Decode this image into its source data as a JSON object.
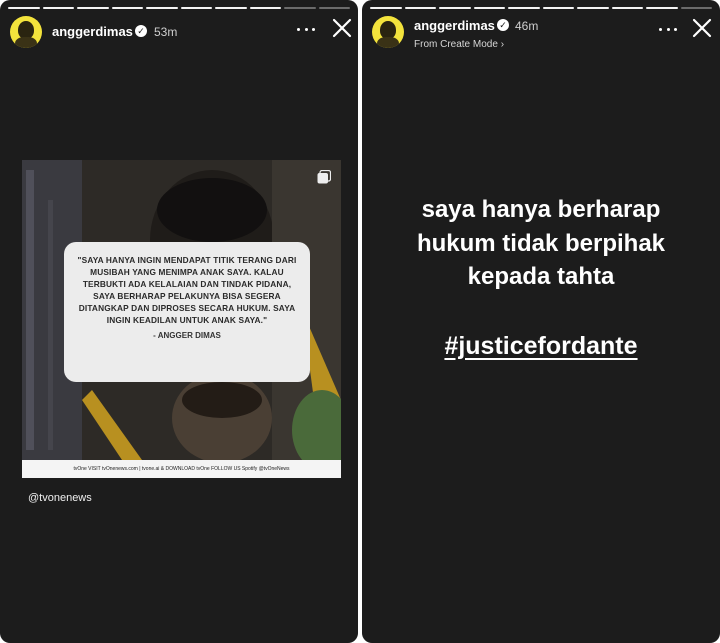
{
  "left_story": {
    "username": "anggerdimas",
    "time": "53m",
    "quote": "\"SAYA HANYA INGIN MENDAPAT TITIK TERANG DARI MUSIBAH YANG MENIMPA ANAK SAYA. KALAU TERBUKTI ADA KELALAIAN DAN TINDAK PIDANA, SAYA BERHARAP PELAKUNYA BISA SEGERA DITANGKAP DAN DIPROSES SECARA HUKUM. SAYA INGIN KEADILAN UNTUK ANAK SAYA.\"",
    "author": "- ANGGER DIMAS",
    "footer": "tvOne  VISIT tvOnenews.com | tvone.ai  & DOWNLOAD tvOne  FOLLOW US  Spotify @tvOneNews",
    "mention": "@tvonenews"
  },
  "right_story": {
    "username": "anggerdimas",
    "time": "46m",
    "subline": "From Create Mode ›",
    "lines": [
      "saya hanya berharap",
      "hukum tidak berpihak",
      "kepada tahta"
    ],
    "hashtag": "#justicefordante"
  },
  "icons": {
    "more": "more-icon",
    "close": "close-icon",
    "verified": "verified-badge-icon",
    "gallery": "gallery-icon"
  },
  "colors": {
    "background": "#1c1c1c",
    "avatar": "#f3e33c",
    "text": "#ffffff"
  }
}
